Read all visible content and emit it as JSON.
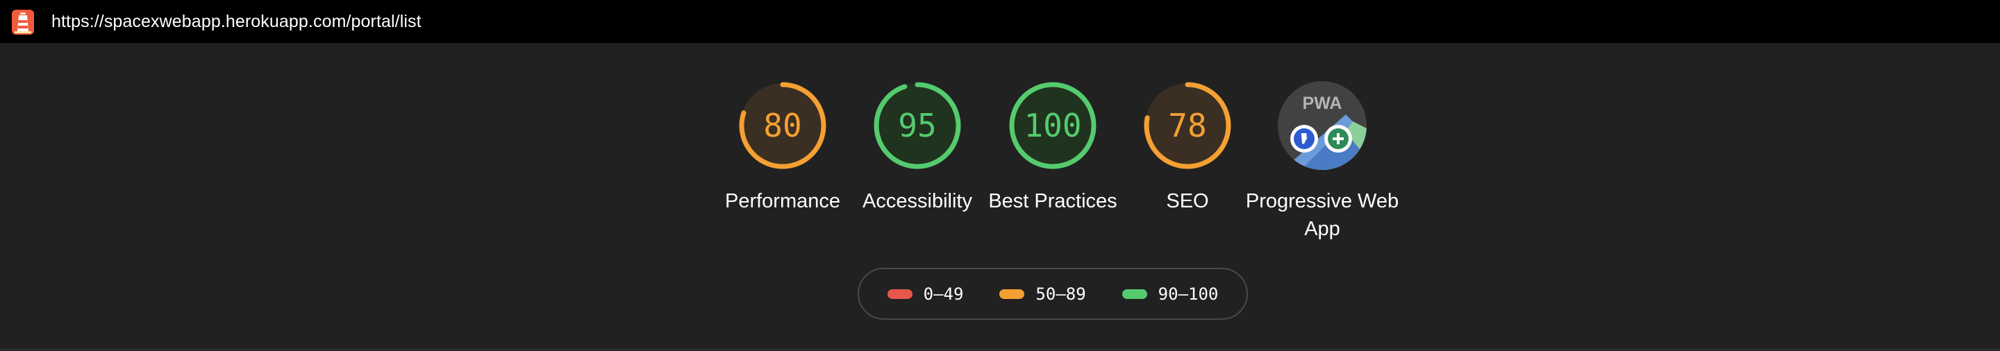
{
  "address_bar": {
    "url": "https://spacexwebapp.herokuapp.com/portal/list",
    "icon": "lighthouse-icon"
  },
  "colors": {
    "fail": "#e8574c",
    "average": "#f5a033",
    "pass": "#55cb6e",
    "track_average": "#3a2f22",
    "track_pass": "#20331f"
  },
  "categories": [
    {
      "id": "performance",
      "label": "Performance",
      "score": "80",
      "value": 80,
      "rating": "average"
    },
    {
      "id": "accessibility",
      "label": "Accessibility",
      "score": "95",
      "value": 95,
      "rating": "pass"
    },
    {
      "id": "best-practices",
      "label": "Best Practices",
      "score": "100",
      "value": 100,
      "rating": "pass"
    },
    {
      "id": "seo",
      "label": "SEO",
      "score": "78",
      "value": 78,
      "rating": "average"
    },
    {
      "id": "pwa",
      "label": "Progressive Web App",
      "badge_text": "PWA",
      "icon": "pwa-badge-icon"
    }
  ],
  "legend": [
    {
      "range": "0–49",
      "rating": "fail"
    },
    {
      "range": "50–89",
      "rating": "average"
    },
    {
      "range": "90–100",
      "rating": "pass"
    }
  ]
}
